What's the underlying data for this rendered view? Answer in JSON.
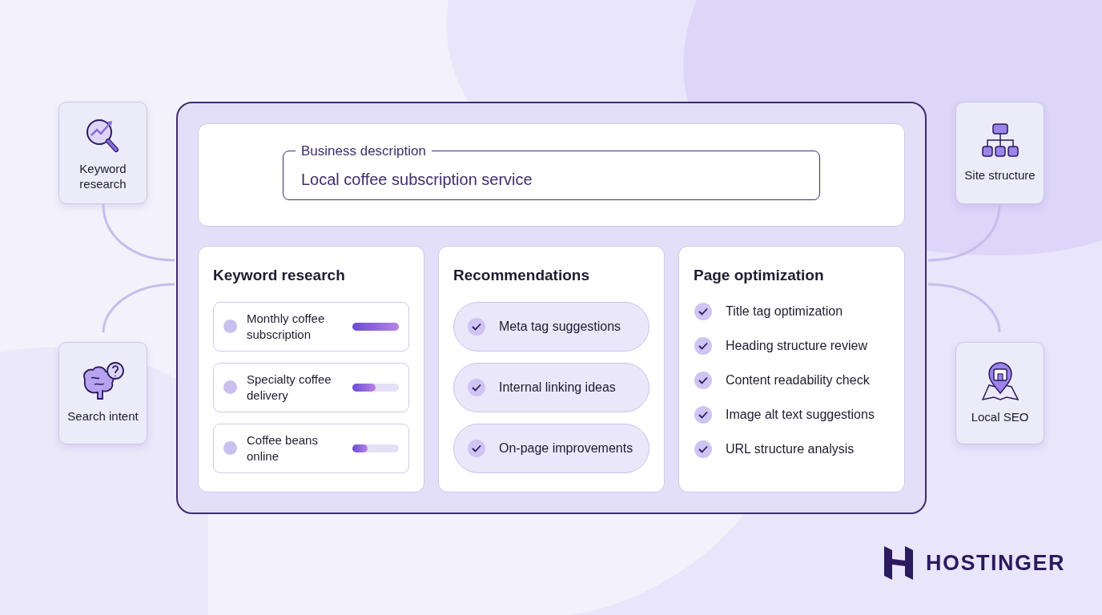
{
  "side_tiles_left": [
    {
      "kind": "search-trend",
      "label": "Keyword research"
    },
    {
      "kind": "brain",
      "label": "Search intent"
    }
  ],
  "side_tiles_right": [
    {
      "kind": "sitemap",
      "label": "Site structure"
    },
    {
      "kind": "map-pin",
      "label": "Local SEO"
    }
  ],
  "business_field": {
    "label": "Business description",
    "value": "Local coffee subscription service"
  },
  "keyword_research": {
    "title": "Keyword research",
    "items": [
      {
        "label": "Monthly coffee subscription",
        "level": 1.0
      },
      {
        "label": "Specialty coffee delivery",
        "level": 0.5
      },
      {
        "label": "Coffee beans online",
        "level": 0.33
      }
    ]
  },
  "recommendations": {
    "title": "Recommendations",
    "items": [
      {
        "label": "Meta tag suggestions",
        "checked": true
      },
      {
        "label": "Internal linking ideas",
        "checked": true
      },
      {
        "label": "On-page improvements",
        "checked": true
      }
    ]
  },
  "page_optimization": {
    "title": "Page optimization",
    "items": [
      {
        "label": "Title tag optimization",
        "checked": true
      },
      {
        "label": "Heading structure review",
        "checked": true
      },
      {
        "label": "Content readability check",
        "checked": true
      },
      {
        "label": "Image alt text suggestions",
        "checked": true
      },
      {
        "label": "URL structure analysis",
        "checked": true
      }
    ]
  },
  "brand": {
    "name": "HOSTINGER"
  }
}
